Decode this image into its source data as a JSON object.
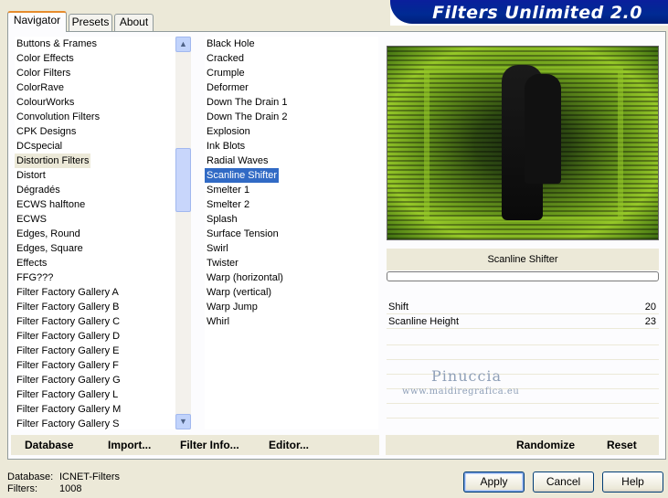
{
  "tabs": [
    {
      "label": "Navigator"
    },
    {
      "label": "Presets"
    },
    {
      "label": "About"
    }
  ],
  "title": "Filters Unlimited 2.0",
  "categories": [
    "Buttons & Frames",
    "Color Effects",
    "Color Filters",
    "ColorRave",
    "ColourWorks",
    "Convolution Filters",
    "CPK Designs",
    "DCspecial",
    "Distortion Filters",
    "Distort",
    "Dégradés",
    "ECWS halftone",
    "ECWS",
    "Edges, Round",
    "Edges, Square",
    "Effects",
    "FFG???",
    "Filter Factory Gallery A",
    "Filter Factory Gallery B",
    "Filter Factory Gallery C",
    "Filter Factory Gallery D",
    "Filter Factory Gallery E",
    "Filter Factory Gallery F",
    "Filter Factory Gallery G",
    "Filter Factory Gallery L",
    "Filter Factory Gallery M",
    "Filter Factory Gallery S"
  ],
  "selected_category": "Distortion Filters",
  "filters": [
    "Black Hole",
    "Cracked",
    "Crumple",
    "Deformer",
    "Down The Drain 1",
    "Down The Drain 2",
    "Explosion",
    "Ink Blots",
    "Radial Waves",
    "Scanline Shifter",
    "Smelter 1",
    "Smelter 2",
    "Splash",
    "Surface Tension",
    "Swirl",
    "Twister",
    "Warp (horizontal)",
    "Warp (vertical)",
    "Warp Jump",
    "Whirl"
  ],
  "selected_filter": "Scanline Shifter",
  "panel": {
    "filter_name": "Scanline Shifter",
    "params": [
      {
        "label": "Shift",
        "value": "20"
      },
      {
        "label": "Scanline Height",
        "value": "23"
      }
    ]
  },
  "watermark": {
    "line1": "Pinuccia",
    "line2": "www.maidiregrafica.eu"
  },
  "toolbar": {
    "database": "Database",
    "import": "Import...",
    "filter_info": "Filter Info...",
    "editor": "Editor...",
    "randomize": "Randomize",
    "reset": "Reset"
  },
  "info": {
    "database_label": "Database:",
    "database_value": "ICNET-Filters",
    "filters_label": "Filters:",
    "filters_value": "1008"
  },
  "buttons": {
    "apply": "Apply",
    "cancel": "Cancel",
    "help": "Help"
  },
  "colors": {
    "selection_blue": "#316ac5",
    "title_blue": "#0a1f9c",
    "tab_accent": "#e68b2c"
  }
}
